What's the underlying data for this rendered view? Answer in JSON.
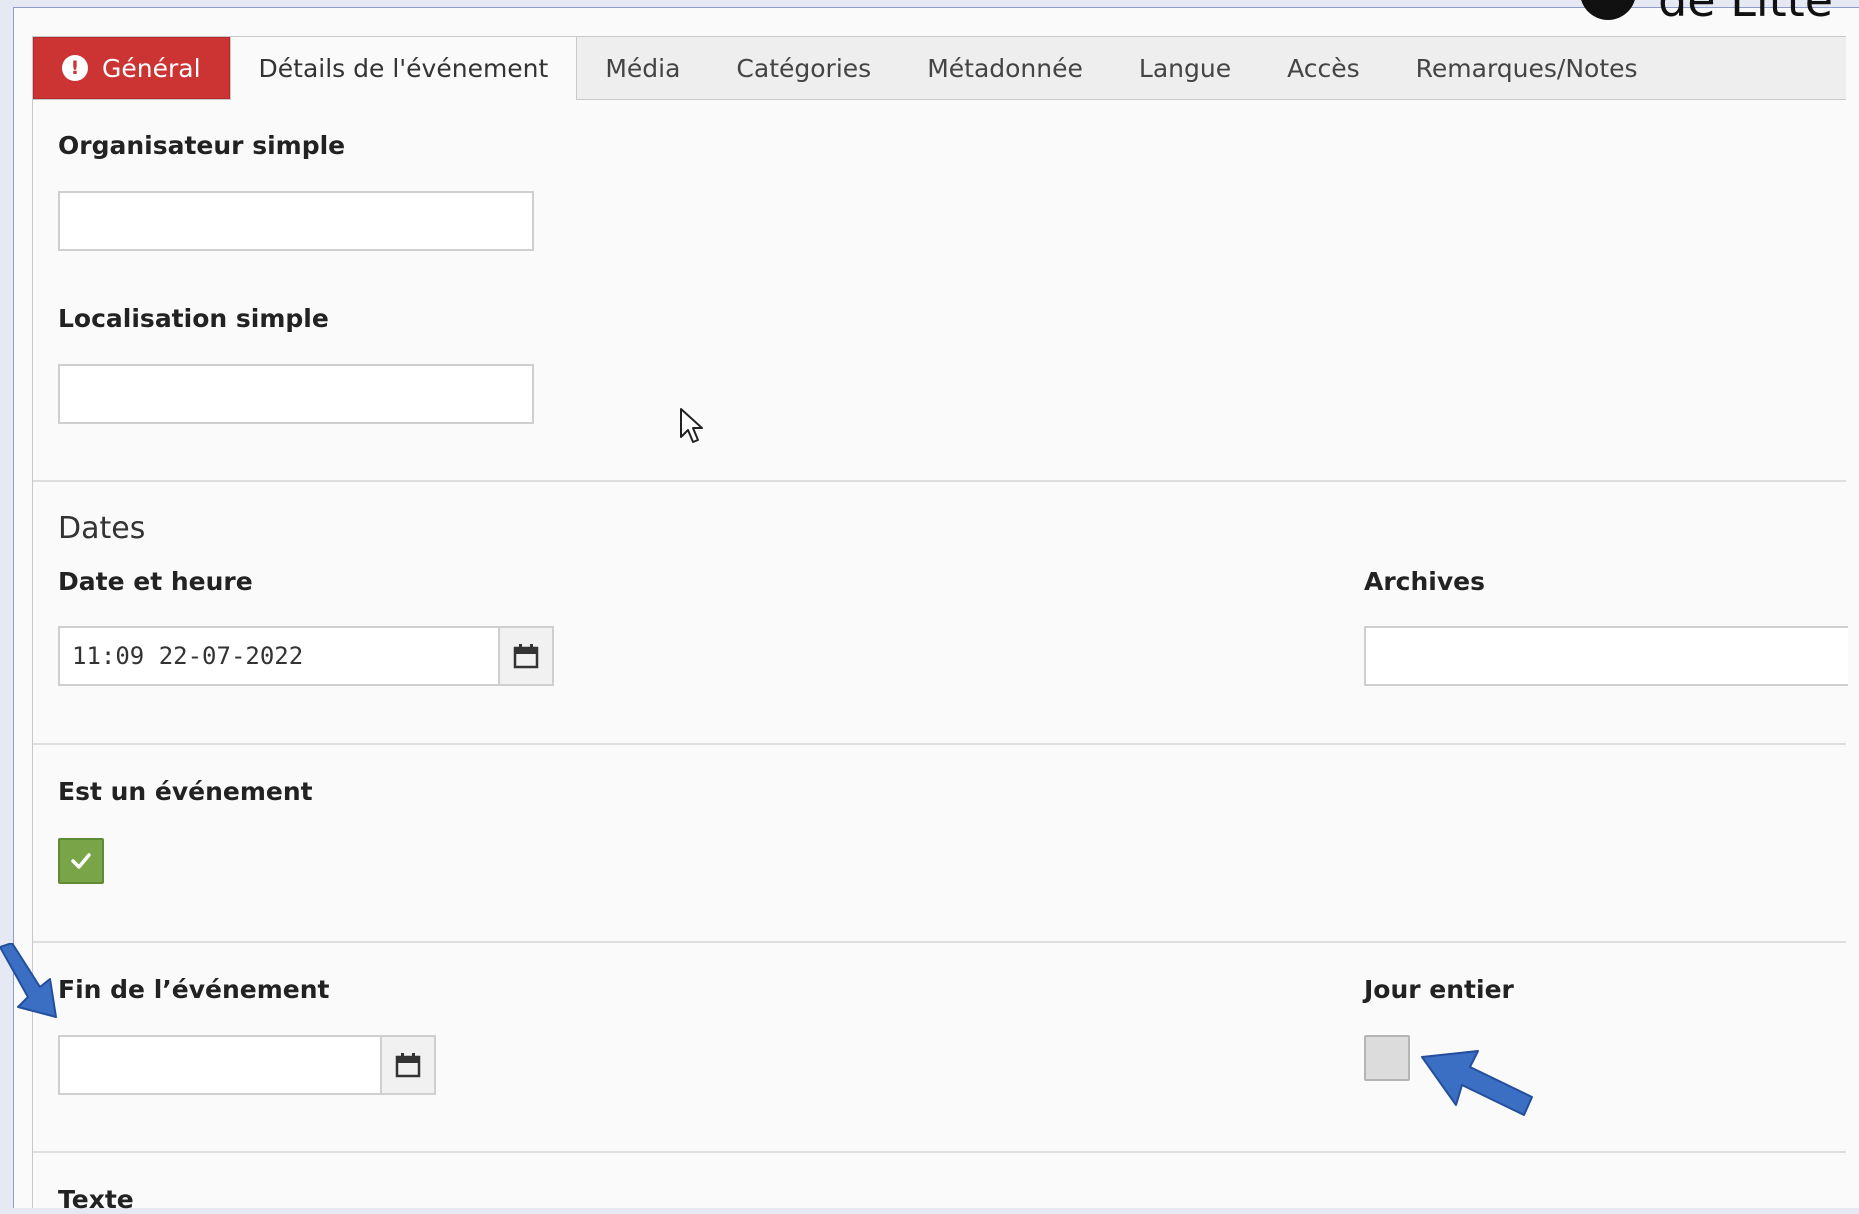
{
  "logo": {
    "text": "de Litte"
  },
  "tabs": [
    {
      "label": "Général",
      "state": "error"
    },
    {
      "label": "Détails de l'événement",
      "state": "active"
    },
    {
      "label": "Média",
      "state": "normal"
    },
    {
      "label": "Catégories",
      "state": "normal"
    },
    {
      "label": "Métadonnée",
      "state": "normal"
    },
    {
      "label": "Langue",
      "state": "normal"
    },
    {
      "label": "Accès",
      "state": "normal"
    },
    {
      "label": "Remarques/Notes",
      "state": "normal"
    }
  ],
  "form": {
    "organizer_label": "Organisateur simple",
    "organizer_value": "",
    "location_label": "Localisation simple",
    "location_value": "",
    "dates_section": "Dates",
    "datetime_label": "Date et heure",
    "datetime_value": "11:09 22-07-2022",
    "archive_label": "Archives",
    "archive_value": "",
    "is_event_label": "Est un événement",
    "is_event_checked": true,
    "event_end_label": "Fin de l’événement",
    "event_end_value": "",
    "full_day_label": "Jour entier",
    "full_day_checked": false,
    "text_label": "Texte"
  },
  "colors": {
    "error_tab": "#cc3333",
    "checkbox_on": "#79a548",
    "annotation_arrow": "#3a6fc4"
  },
  "icons": {
    "tab_error": "exclamation-circle-icon",
    "calendar": "calendar-icon",
    "check": "check-icon",
    "cursor": "mouse-pointer-icon",
    "annotation": "arrow-annotation-icon"
  }
}
